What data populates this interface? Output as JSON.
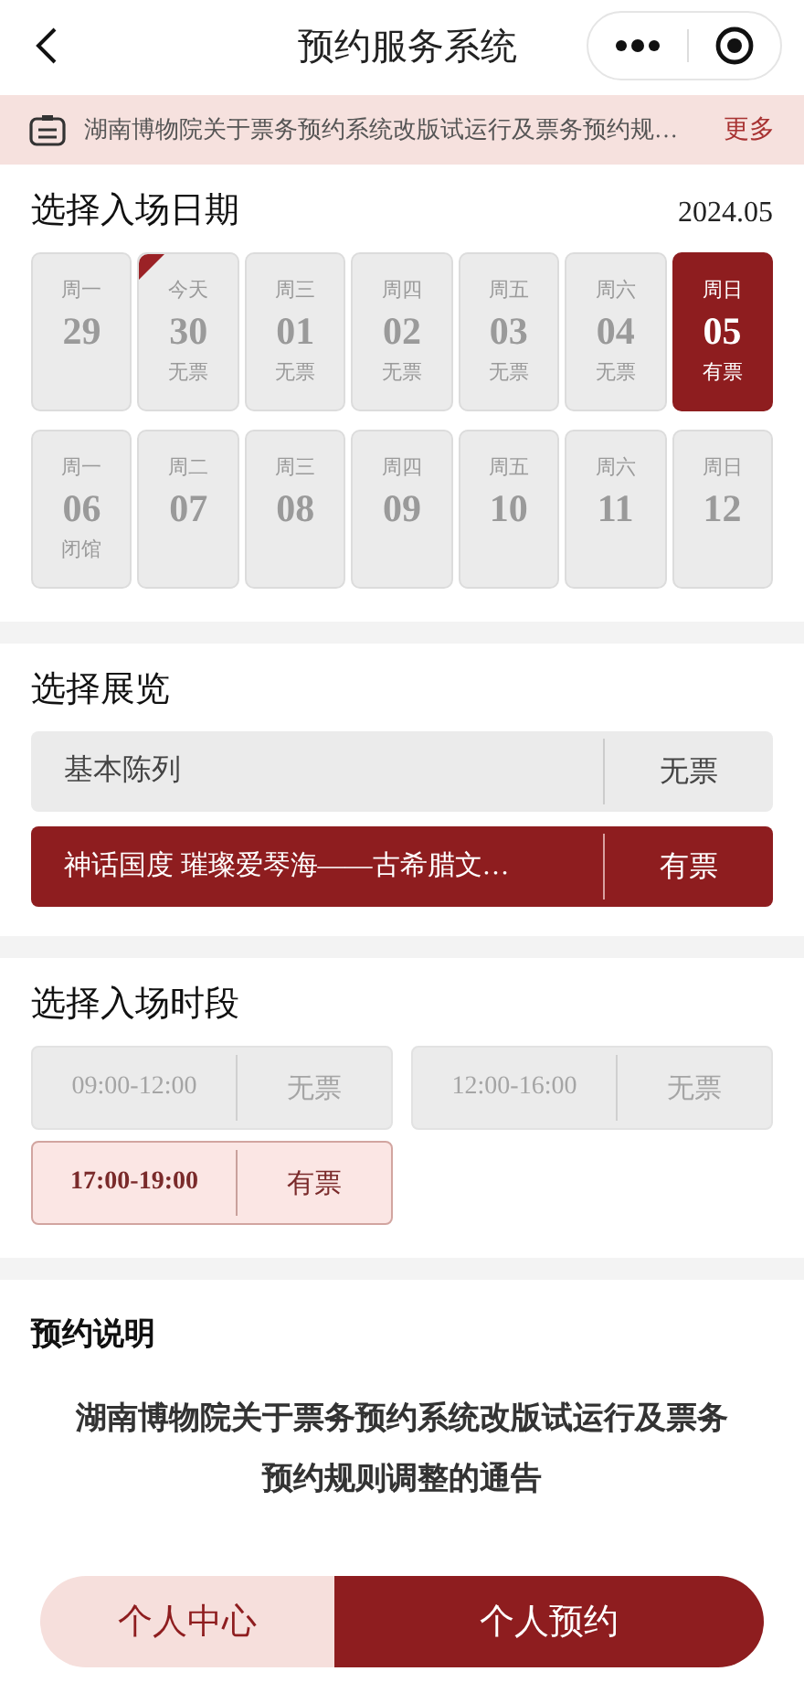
{
  "nav": {
    "title": "预约服务系统"
  },
  "notice": {
    "text": "湖南博物院关于票务预约系统改版试运行及票务预约规…",
    "more": "更多"
  },
  "date_section": {
    "title": "选择入场日期",
    "month": "2024.05",
    "days": [
      {
        "weekday": "周一",
        "day": "29",
        "selected": false,
        "today": false
      },
      {
        "weekday": "今天",
        "day": "30",
        "status": "无票",
        "selected": false,
        "today": true
      },
      {
        "weekday": "周三",
        "day": "01",
        "status": "无票",
        "selected": false,
        "today": false
      },
      {
        "weekday": "周四",
        "day": "02",
        "status": "无票",
        "selected": false,
        "today": false
      },
      {
        "weekday": "周五",
        "day": "03",
        "status": "无票",
        "selected": false,
        "today": false
      },
      {
        "weekday": "周六",
        "day": "04",
        "status": "无票",
        "selected": false,
        "today": false
      },
      {
        "weekday": "周日",
        "day": "05",
        "status": "有票",
        "selected": true,
        "today": false
      },
      {
        "weekday": "周一",
        "day": "06",
        "status": "闭馆",
        "selected": false,
        "today": false
      },
      {
        "weekday": "周二",
        "day": "07",
        "selected": false,
        "today": false
      },
      {
        "weekday": "周三",
        "day": "08",
        "selected": false,
        "today": false
      },
      {
        "weekday": "周四",
        "day": "09",
        "selected": false,
        "today": false
      },
      {
        "weekday": "周五",
        "day": "10",
        "selected": false,
        "today": false
      },
      {
        "weekday": "周六",
        "day": "11",
        "selected": false,
        "today": false
      },
      {
        "weekday": "周日",
        "day": "12",
        "selected": false,
        "today": false
      }
    ]
  },
  "exhibition_section": {
    "title": "选择展览",
    "items": [
      {
        "name": "基本陈列",
        "status": "无票",
        "selected": false
      },
      {
        "name": "神话国度 璀璨爱琴海——古希腊文…",
        "status": "有票",
        "selected": true
      }
    ]
  },
  "time_section": {
    "title": "选择入场时段",
    "slots": [
      {
        "time": "09:00-12:00",
        "status": "无票",
        "available": false,
        "selected": false
      },
      {
        "time": "12:00-16:00",
        "status": "无票",
        "available": false,
        "selected": false
      },
      {
        "time": "17:00-19:00",
        "status": "有票",
        "available": true,
        "selected": true
      }
    ]
  },
  "instructions": {
    "title": "预约说明",
    "notice_title": "湖南博物院关于票务预约系统改版试运行及票务预约规则调整的通告"
  },
  "bottom_bar": [
    {
      "label": "个人中心",
      "kind": "secondary"
    },
    {
      "label": "个人预约",
      "kind": "primary"
    }
  ]
}
